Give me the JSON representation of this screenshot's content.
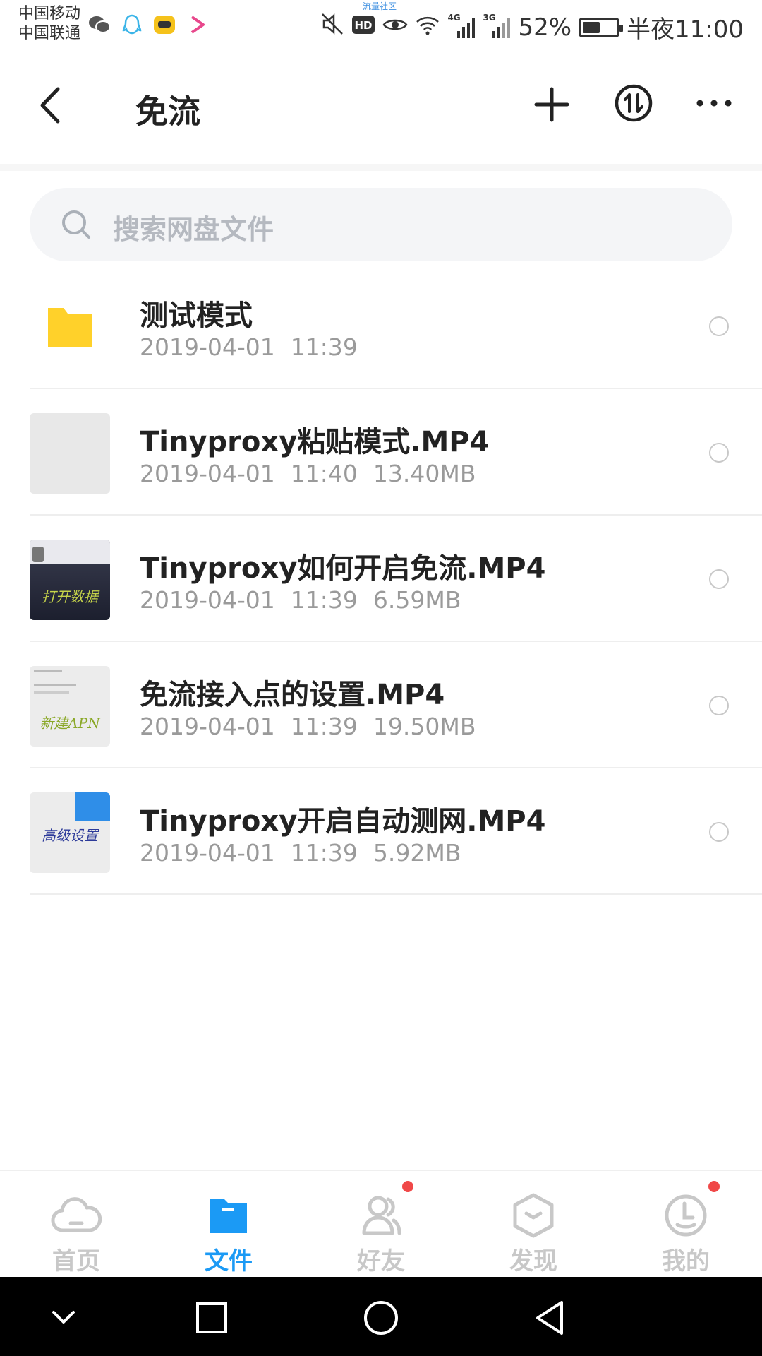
{
  "status_bar": {
    "carrier_1": "中国移动",
    "carrier_2": "中国联通",
    "watermark": "流量社区",
    "network_4g": "4G",
    "network_3g": "3G",
    "battery_percent": "52%",
    "battery_level": 0.52,
    "time": "半夜11:00"
  },
  "header": {
    "title": "免流"
  },
  "search": {
    "placeholder": "搜索网盘文件"
  },
  "files": [
    {
      "name": "测试模式",
      "date": "2019-04-01",
      "time": "11:39",
      "size": "",
      "type": "folder"
    },
    {
      "name": "Tinyproxy粘贴模式.MP4",
      "date": "2019-04-01",
      "time": "11:40",
      "size": "13.40MB",
      "type": "video"
    },
    {
      "name": "Tinyproxy如何开启免流.MP4",
      "date": "2019-04-01",
      "time": "11:39",
      "size": "6.59MB",
      "type": "video",
      "thumb_text": "打开数据"
    },
    {
      "name": "免流接入点的设置.MP4",
      "date": "2019-04-01",
      "time": "11:39",
      "size": "19.50MB",
      "type": "video",
      "thumb_text": "新建APN"
    },
    {
      "name": "Tinyproxy开启自动测网.MP4",
      "date": "2019-04-01",
      "time": "11:39",
      "size": "5.92MB",
      "type": "video",
      "thumb_text": "高级设置"
    }
  ],
  "bottom_nav": [
    {
      "label": "首页",
      "icon": "cloud-icon",
      "active": false,
      "badge": false
    },
    {
      "label": "文件",
      "icon": "folder-icon",
      "active": true,
      "badge": false
    },
    {
      "label": "好友",
      "icon": "friends-icon",
      "active": false,
      "badge": true
    },
    {
      "label": "发现",
      "icon": "discover-icon",
      "active": false,
      "badge": false
    },
    {
      "label": "我的",
      "icon": "profile-icon",
      "active": false,
      "badge": true
    }
  ],
  "colors": {
    "accent": "#1b9af5",
    "folder": "#ffd12a",
    "badge": "#f04848",
    "muted_text": "#9a9a9a"
  }
}
